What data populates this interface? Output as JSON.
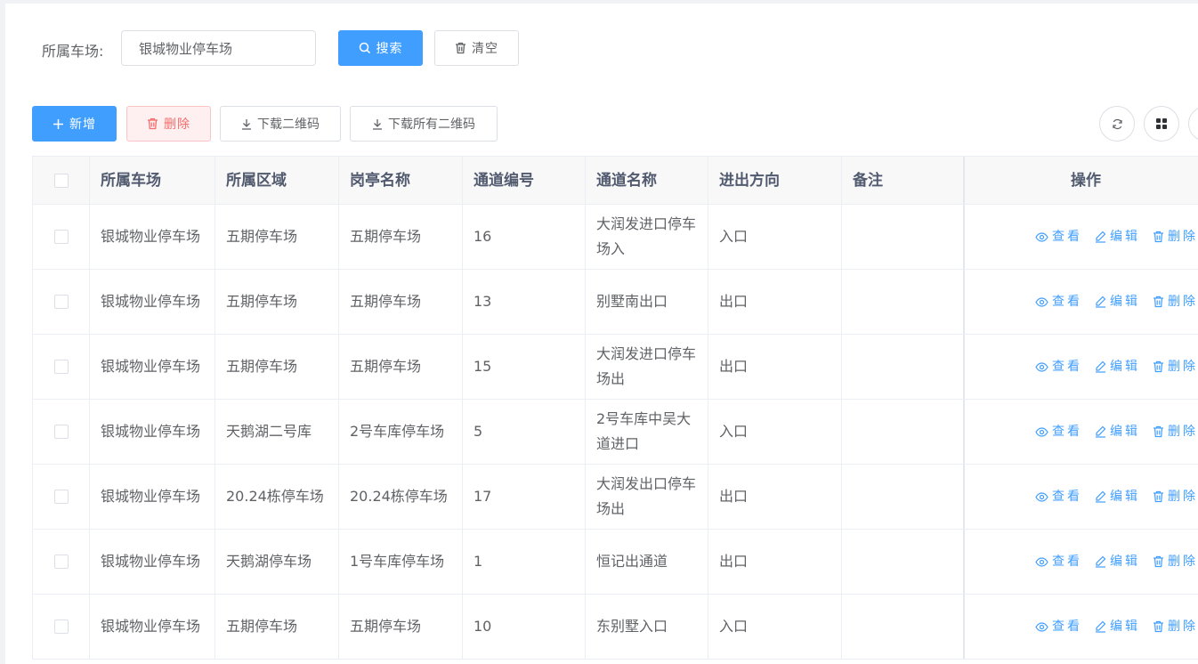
{
  "search": {
    "label": "所属车场:",
    "value": "银城物业停车场",
    "search_button": "搜索",
    "clear_button": "清空"
  },
  "toolbar": {
    "add_button": "新增",
    "delete_button": "删除",
    "download_button": "下载二维码",
    "download_all_button": "下载所有二维码"
  },
  "table": {
    "headers": [
      "所属车场",
      "所属区域",
      "岗亭名称",
      "通道编号",
      "通道名称",
      "进出方向",
      "备注",
      "操作"
    ],
    "rows": [
      [
        "银城物业停车场",
        "五期停车场",
        "五期停车场",
        "16",
        "大润发进口停车场入",
        "入口",
        ""
      ],
      [
        "银城物业停车场",
        "五期停车场",
        "五期停车场",
        "13",
        "别墅南出口",
        "出口",
        ""
      ],
      [
        "银城物业停车场",
        "五期停车场",
        "五期停车场",
        "15",
        "大润发进口停车场出",
        "出口",
        ""
      ],
      [
        "银城物业停车场",
        "天鹅湖二号库",
        "2号车库停车场",
        "5",
        "2号车库中吴大道进口",
        "入口",
        ""
      ],
      [
        "银城物业停车场",
        "20.24栋停车场",
        "20.24栋停车场",
        "17",
        "大润发出口停车场出",
        "出口",
        ""
      ],
      [
        "银城物业停车场",
        "天鹅湖停车场",
        "1号车库停车场",
        "1",
        "恒记出通道",
        "出口",
        ""
      ],
      [
        "银城物业停车场",
        "五期停车场",
        "五期停车场",
        "10",
        "东别墅入口",
        "入口",
        ""
      ]
    ],
    "actions": {
      "view": "查看",
      "edit": "编辑",
      "delete": "删除"
    }
  },
  "colors": {
    "primary": "#409eff",
    "danger": "#f56c6c"
  }
}
